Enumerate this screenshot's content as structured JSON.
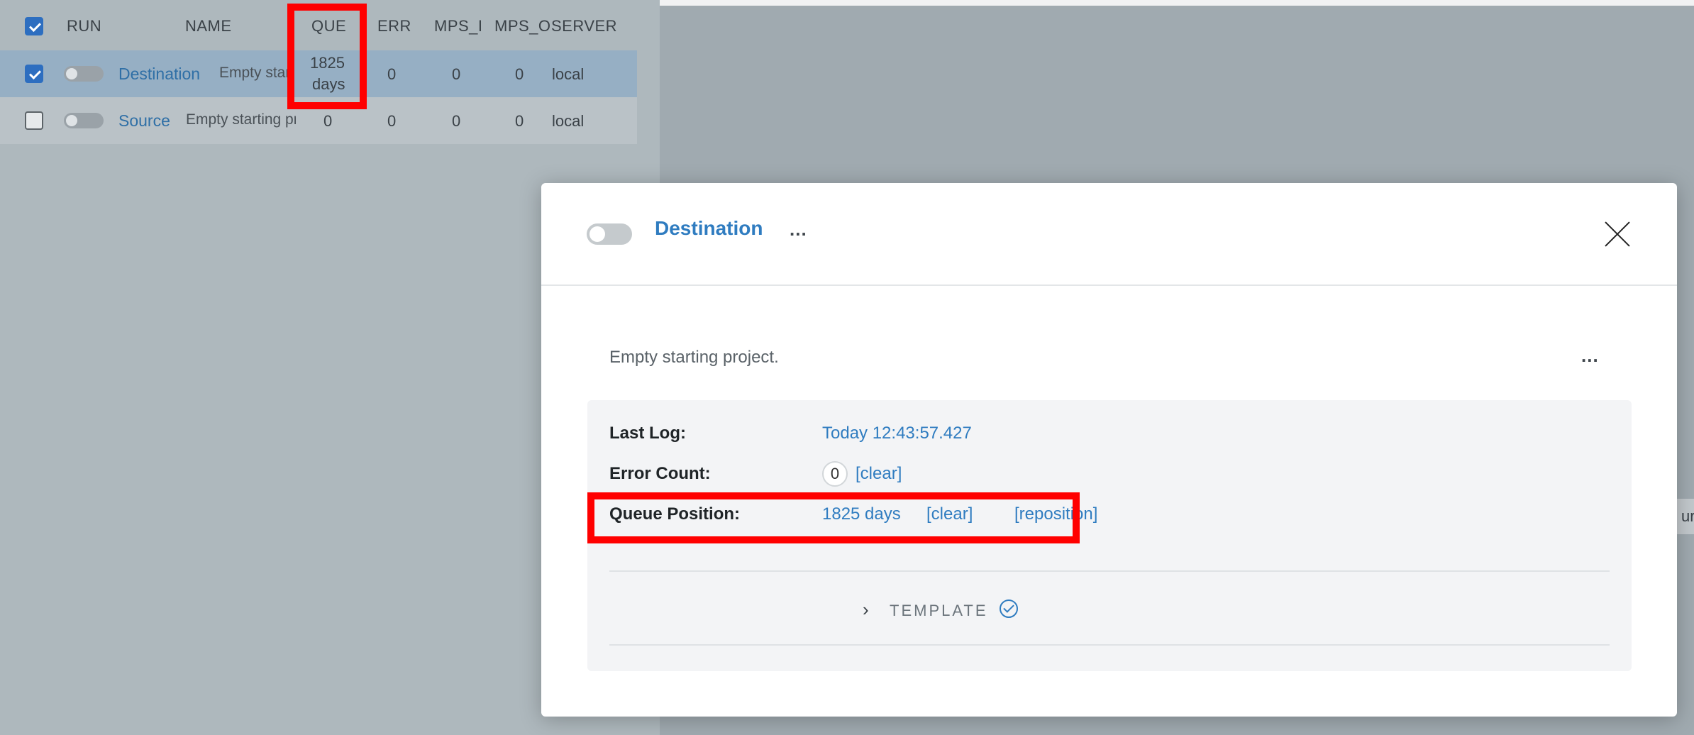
{
  "table": {
    "headers": {
      "run": "RUN",
      "name": "NAME",
      "que": "QUE",
      "err": "ERR",
      "mps_in": "MPS_I",
      "mps_out": "MPS_O",
      "server": "SERVER"
    },
    "rows": [
      {
        "checked": true,
        "name": "Destination",
        "description": "Empty star",
        "que_line1": "1825",
        "que_line2": "days",
        "err": "0",
        "mps_in": "0",
        "mps_out": "0",
        "server": "local"
      },
      {
        "checked": false,
        "name": "Source",
        "description": "Empty starting pr",
        "que": "0",
        "err": "0",
        "mps_in": "0",
        "mps_out": "0",
        "server": "local"
      }
    ]
  },
  "modal": {
    "title": "Destination",
    "header_more": "...",
    "description": "Empty starting project.",
    "desc_more": "...",
    "last_log_label": "Last Log:",
    "last_log_value": "Today 12:43:57.427",
    "error_count_label": "Error Count:",
    "error_count_value": "0",
    "error_clear": "[clear]",
    "queue_label": "Queue Position:",
    "queue_value": "1825 days",
    "queue_clear": "[clear]",
    "queue_reposition": "[reposition]",
    "template_label": "TEMPLATE",
    "template_chevron": "›"
  },
  "edge_peek_text": "ur",
  "colors": {
    "accent": "#2f7cc0",
    "highlight": "#ff0000",
    "selected_row": "#96afc4"
  }
}
